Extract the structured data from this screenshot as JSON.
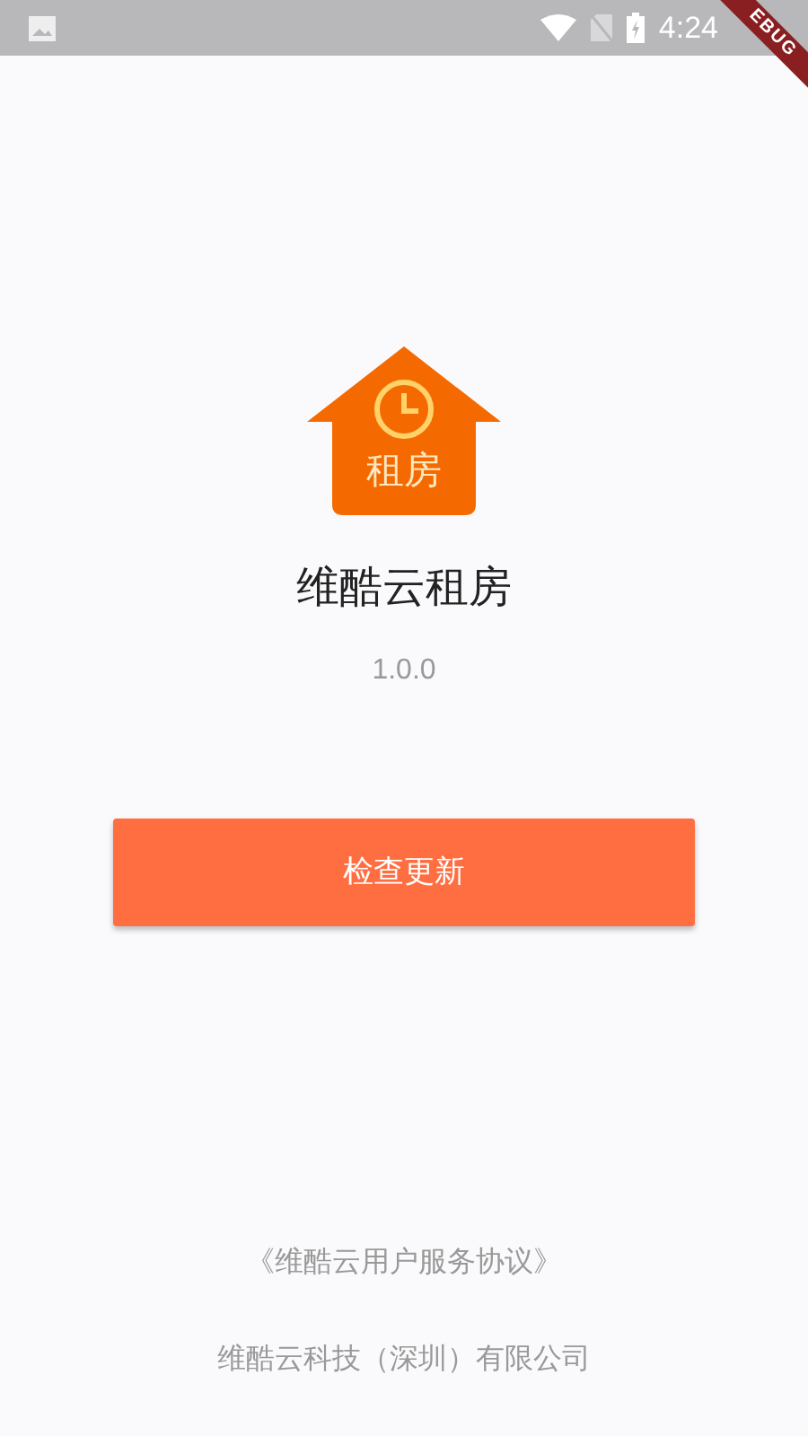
{
  "status_bar": {
    "time": "4:24",
    "debug_banner": "EBUG"
  },
  "app": {
    "icon_label": "租房",
    "name": "维酷云租房",
    "version": "1.0.0"
  },
  "update_button": "检查更新",
  "agreement_link": "《维酷云用户服务协议》",
  "company": "维酷云科技（深圳）有限公司"
}
